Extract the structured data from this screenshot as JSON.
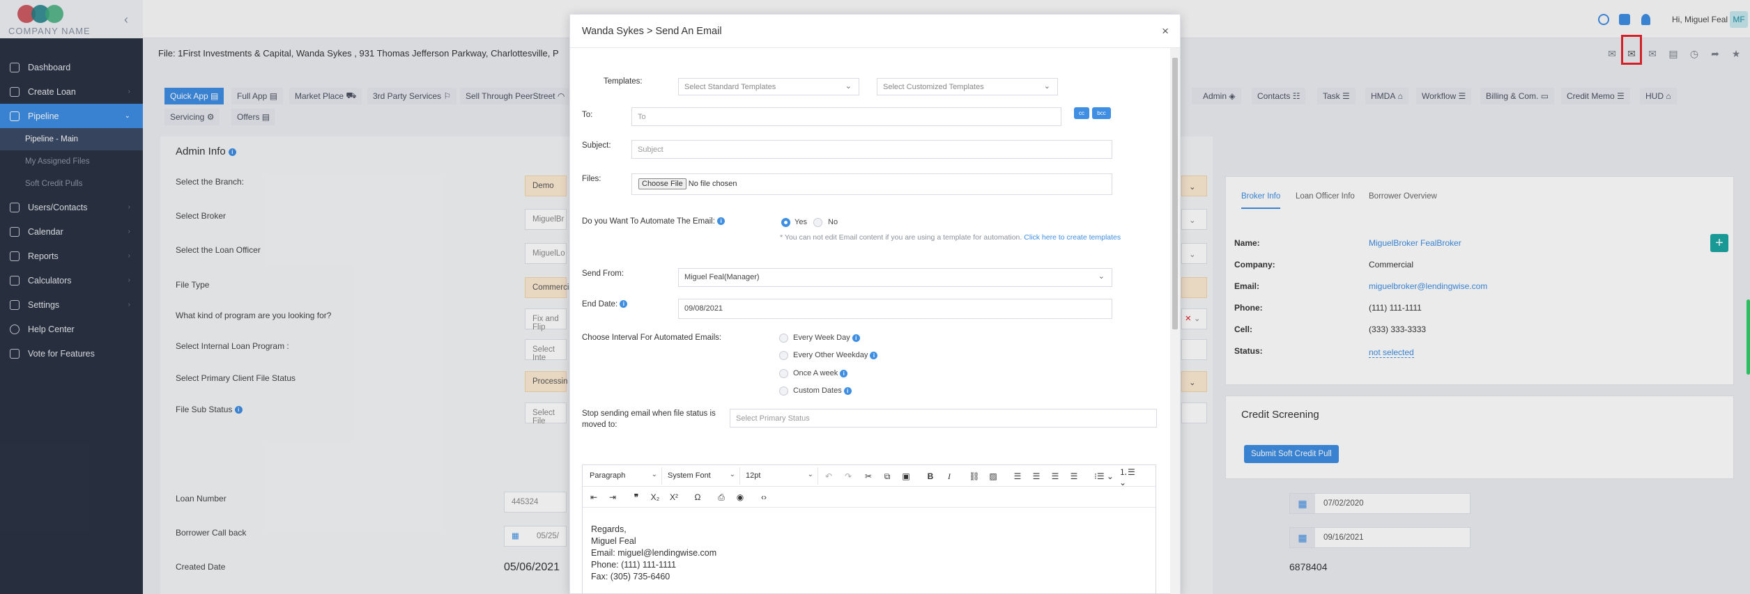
{
  "brand": {
    "company_name": "COMPANY NAME"
  },
  "sidebar": {
    "items": [
      {
        "label": "Dashboard",
        "icon": "dashboard-icon"
      },
      {
        "label": "Create Loan",
        "icon": "file-icon"
      },
      {
        "label": "Pipeline",
        "icon": "pipeline-icon",
        "active": true
      },
      {
        "label": "Users/Contacts",
        "icon": "users-icon"
      },
      {
        "label": "Calendar",
        "icon": "calendar-icon"
      },
      {
        "label": "Reports",
        "icon": "reports-icon"
      },
      {
        "label": "Calculators",
        "icon": "calculator-icon"
      },
      {
        "label": "Settings",
        "icon": "wrench-icon"
      },
      {
        "label": "Help Center",
        "icon": "help-icon"
      },
      {
        "label": "Vote for Features",
        "icon": "rocket-icon"
      }
    ],
    "pipeline_sub": [
      "Pipeline - Main",
      "My Assigned Files",
      "Soft Credit Pulls"
    ]
  },
  "topbar": {
    "greeting": "Hi, Miguel Feal",
    "avatar": "MF"
  },
  "file_header": {
    "title": "File: 1First Investments & Capital, Wanda Sykes , 931 Thomas Jefferson Parkway, Charlottesville, P"
  },
  "tabs": {
    "row1": [
      "Quick App",
      "Full App",
      "Market Place",
      "3rd Party Services",
      "Sell Through PeerStreet",
      "Admin",
      "Contacts",
      "Task",
      "HMDA",
      "Workflow",
      "Billing & Com.",
      "Credit Memo",
      "HUD"
    ],
    "row2": [
      "Servicing",
      "Offers"
    ]
  },
  "admin": {
    "title": "Admin Info",
    "labels": [
      "Select the Branch:",
      "Select Broker",
      "Select the Loan Officer",
      "File Type",
      "What kind of program are you looking for?",
      "Select Internal Loan Program :",
      "Select Primary Client File Status",
      "File Sub Status",
      "Loan Number",
      "Borrower Call back",
      "Created Date"
    ],
    "values": {
      "branch": "Demo",
      "broker": "MiguelBr",
      "loan_officer": "MiguelLo",
      "file_type": "Commercia",
      "program": "Fix and Flip",
      "internal_program": "Select Inte",
      "primary_status": "Processin",
      "sub_status": "Select File",
      "loan_number": "445324",
      "callback": "05/25/",
      "created_date": "05/06/2021",
      "right_date1": "07/02/2020",
      "right_date2": "09/16/2021",
      "right_number": "6878404"
    }
  },
  "broker_card": {
    "tabs": [
      "Broker Info",
      "Loan Officer Info",
      "Borrower Overview"
    ],
    "rows": [
      {
        "label": "Name:",
        "value": "MiguelBroker FealBroker",
        "link": true
      },
      {
        "label": "Company:",
        "value": "Commercial",
        "link": false
      },
      {
        "label": "Email:",
        "value": "miguelbroker@lendingwise.com",
        "link": true
      },
      {
        "label": "Phone:",
        "value": "(111) 111-1111",
        "link": false
      },
      {
        "label": "Cell:",
        "value": "(333) 333-3333",
        "link": false
      },
      {
        "label": "Status:",
        "value": "not selected",
        "link": true
      }
    ]
  },
  "credit": {
    "title": "Credit Screening",
    "button": "Submit Soft Credit Pull"
  },
  "modal": {
    "title": "Wanda Sykes > Send An Email",
    "templates_label": "Templates:",
    "standard_templates": "Select Standard Templates",
    "custom_templates": "Select Customized Templates",
    "to_label": "To:",
    "to_placeholder": "To",
    "cc": "cc",
    "bcc": "bcc",
    "subject_label": "Subject:",
    "subject_placeholder": "Subject",
    "files_label": "Files:",
    "choose_file": "Choose File",
    "no_file": "No file chosen",
    "automate_label": "Do you Want To Automate The Email:",
    "yes": "Yes",
    "no": "No",
    "automate_note": "* You can not edit Email content if you are using a template for automation.",
    "automate_link": "Click here to create templates",
    "send_from_label": "Send From:",
    "send_from": "Miguel Feal(Manager)",
    "end_date_label": "End Date:",
    "end_date": "09/08/2021",
    "interval_label": "Choose Interval For Automated Emails:",
    "intervals": [
      "Every Week Day",
      "Every Other Weekday",
      "Once A week",
      "Custom Dates"
    ],
    "stop_label": "Stop sending email when file status is moved to:",
    "stop_placeholder": "Select Primary Status",
    "editor": {
      "block": "Paragraph",
      "font": "System Font",
      "size": "12pt",
      "lines": [
        "Regards,",
        "Miguel Feal",
        "Email: miguel@lendingwise.com",
        "Phone: (111) 111-1111",
        "Fax: (305) 735-6460"
      ]
    }
  }
}
